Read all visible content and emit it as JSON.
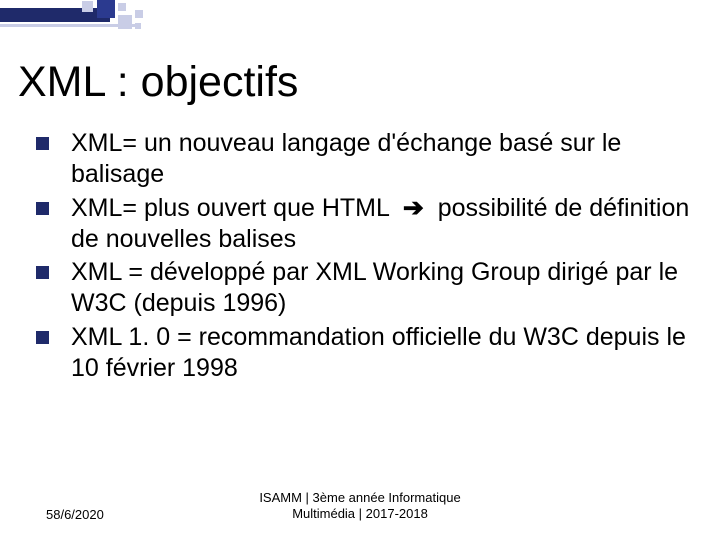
{
  "title": "XML : objectifs",
  "items": [
    {
      "text": "XML= un nouveau langage d'échange basé sur le balisage"
    },
    {
      "text": "XML= plus ouvert que HTML  ➔  possibilité de définition de nouvelles balises",
      "arrow": true
    },
    {
      "text": "XML = développé par XML Working Group dirigé par le W3C (depuis 1996)"
    },
    {
      "text": "XML 1. 0 = recommandation officielle du W3C depuis le 10 février 1998"
    }
  ],
  "footer": {
    "date": "58/6/2020",
    "center_line1": "ISAMM | 3ème année Informatique",
    "center_line2": "Multimédia | 2017-2018"
  }
}
